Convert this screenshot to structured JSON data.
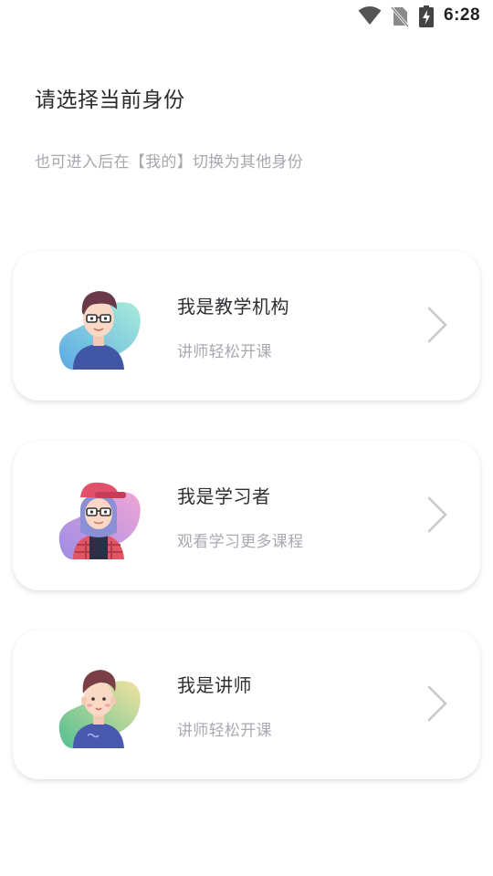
{
  "status_bar": {
    "time": "6:28",
    "icons": [
      "wifi-icon",
      "no-sim-icon",
      "battery-charging-icon"
    ]
  },
  "header": {
    "title": "请选择当前身份",
    "subtitle": "也可进入后在【我的】切换为其他身份"
  },
  "roles": [
    {
      "title": "我是教学机构",
      "description": "讲师轻松开课",
      "avatar": "institution-avatar-icon"
    },
    {
      "title": "我是学习者",
      "description": "观看学习更多课程",
      "avatar": "learner-avatar-icon"
    },
    {
      "title": "我是讲师",
      "description": "讲师轻松开课",
      "avatar": "teacher-avatar-icon"
    }
  ],
  "colors": {
    "title_text": "#2b2b2b",
    "secondary_text": "#a7a7ad",
    "chevron": "#c8c8cc",
    "card_background": "#ffffff"
  }
}
